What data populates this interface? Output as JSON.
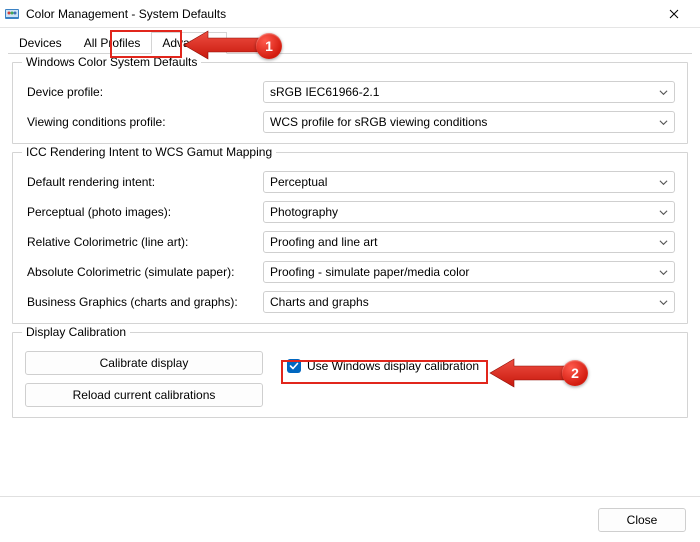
{
  "window": {
    "title": "Color Management - System Defaults"
  },
  "tabs": {
    "devices": "Devices",
    "all_profiles": "All Profiles",
    "advanced": "Advanced"
  },
  "groups": {
    "wcs": {
      "title": "Windows Color System Defaults",
      "device_profile_label": "Device profile:",
      "device_profile_value": "sRGB IEC61966-2.1",
      "viewing_label": "Viewing conditions profile:",
      "viewing_value": "WCS profile for sRGB viewing conditions"
    },
    "icc": {
      "title": "ICC Rendering Intent to WCS Gamut Mapping",
      "default_intent_label": "Default rendering intent:",
      "default_intent_value": "Perceptual",
      "perceptual_label": "Perceptual (photo images):",
      "perceptual_value": "Photography",
      "relcol_label": "Relative Colorimetric (line art):",
      "relcol_value": "Proofing and line art",
      "abscol_label": "Absolute Colorimetric (simulate paper):",
      "abscol_value": "Proofing - simulate paper/media color",
      "biz_label": "Business Graphics (charts and graphs):",
      "biz_value": "Charts and graphs"
    },
    "cal": {
      "title": "Display Calibration",
      "button_calibrate": "Calibrate display",
      "button_reload": "Reload current calibrations",
      "checkbox_label": "Use Windows display calibration"
    }
  },
  "footer": {
    "close": "Close"
  },
  "annotations": {
    "one": "1",
    "two": "2"
  }
}
